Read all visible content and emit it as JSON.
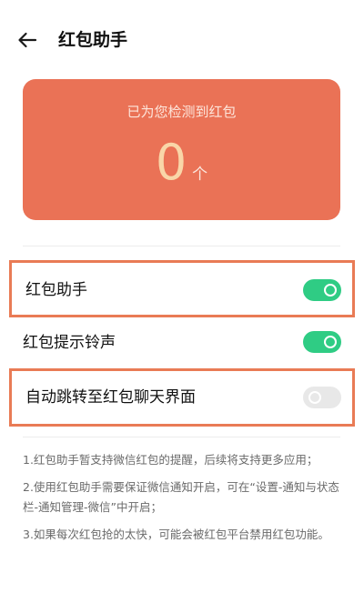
{
  "header": {
    "back_icon": "arrow-left-icon",
    "title": "红包助手"
  },
  "counter": {
    "caption": "已为您检测到红包",
    "value": "0",
    "unit": "个",
    "card_color": "#ea7256"
  },
  "settings": [
    {
      "label": "红包助手",
      "enabled": true,
      "highlighted": true
    },
    {
      "label": "红包提示铃声",
      "enabled": true,
      "highlighted": false
    },
    {
      "label": "自动跳转至红包聊天界面",
      "enabled": false,
      "highlighted": true
    }
  ],
  "toggle_on_color": "#2fcc84",
  "highlight_color": "#e97b55",
  "notes": [
    "1.红包助手暂支持微信红包的提醒，后续将支持更多应用；",
    "2.使用红包助手需要保证微信通知开启，可在“设置-通知与状态栏-通知管理-微信”中开启；",
    "3.如果每次红包抢的太快，可能会被红包平台禁用红包功能。"
  ]
}
